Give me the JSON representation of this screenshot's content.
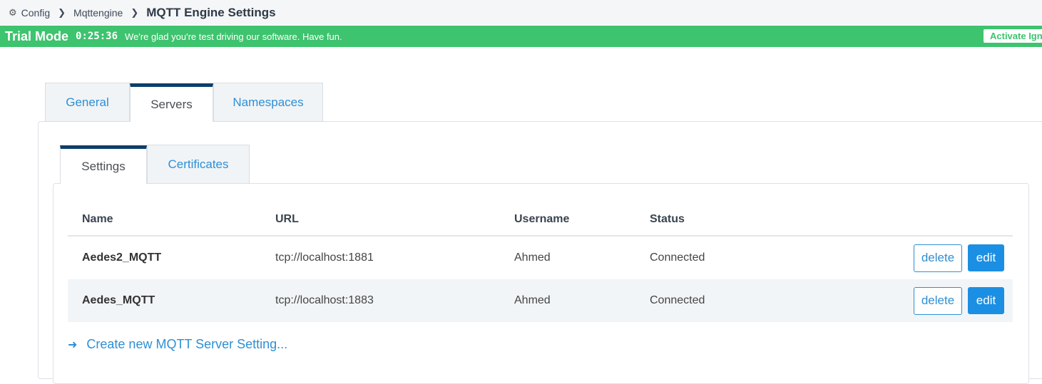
{
  "breadcrumb": {
    "items": [
      "Config",
      "Mqttengine"
    ],
    "current": "MQTT Engine Settings"
  },
  "trial": {
    "mode": "Trial Mode",
    "timer": "0:25:36",
    "message": "We're glad you're test driving our software. Have fun.",
    "activate": "Activate Ignition"
  },
  "tabs": [
    "General",
    "Servers",
    "Namespaces"
  ],
  "subtabs": [
    "Settings",
    "Certificates"
  ],
  "table": {
    "headers": [
      "Name",
      "URL",
      "Username",
      "Status"
    ],
    "rows": [
      {
        "name": "Aedes2_MQTT",
        "url": "tcp://localhost:1881",
        "username": "Ahmed",
        "status": "Connected"
      },
      {
        "name": "Aedes_MQTT",
        "url": "tcp://localhost:1883",
        "username": "Ahmed",
        "status": "Connected"
      }
    ],
    "delete_label": "delete",
    "edit_label": "edit"
  },
  "create_link": "Create new MQTT Server Setting...",
  "colors": {
    "trial_green": "#3ec36e",
    "link_blue": "#2e8fd5",
    "edit_blue": "#1b8fe3",
    "active_tab_border": "#0b3f6b"
  }
}
